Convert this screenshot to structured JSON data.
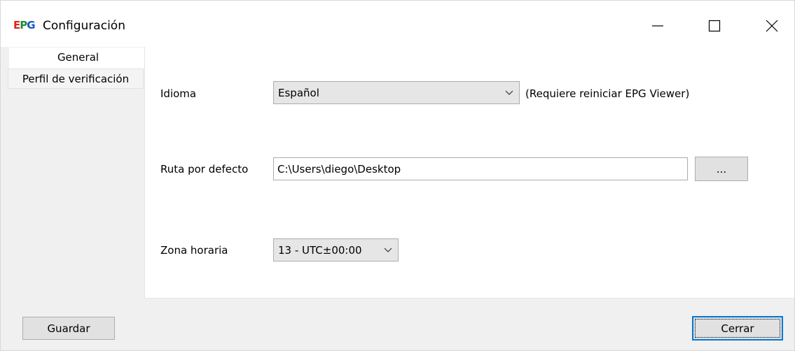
{
  "window": {
    "title": "Configuración",
    "logo": {
      "e": "E",
      "p": "P",
      "g": "G"
    },
    "controls": [
      "minimize-icon",
      "maximize-icon",
      "close-icon"
    ]
  },
  "tabs": [
    {
      "label": "General",
      "active": true
    },
    {
      "label": "Perfil de verificación",
      "active": false
    }
  ],
  "general": {
    "language": {
      "label": "Idioma",
      "value": "Español",
      "note": "(Requiere reiniciar EPG Viewer)"
    },
    "default_path": {
      "label": "Ruta por defecto",
      "value": "C:\\Users\\diego\\Desktop",
      "browse_label": "..."
    },
    "timezone": {
      "label": "Zona horaria",
      "value": "13 - UTC±00:00"
    }
  },
  "footer": {
    "save_label": "Guardar",
    "close_label": "Cerrar"
  },
  "colors": {
    "accent": "#0078d7",
    "logo_e": "#d9261c",
    "logo_p": "#1f8a3b",
    "logo_g": "#1a56c4"
  }
}
